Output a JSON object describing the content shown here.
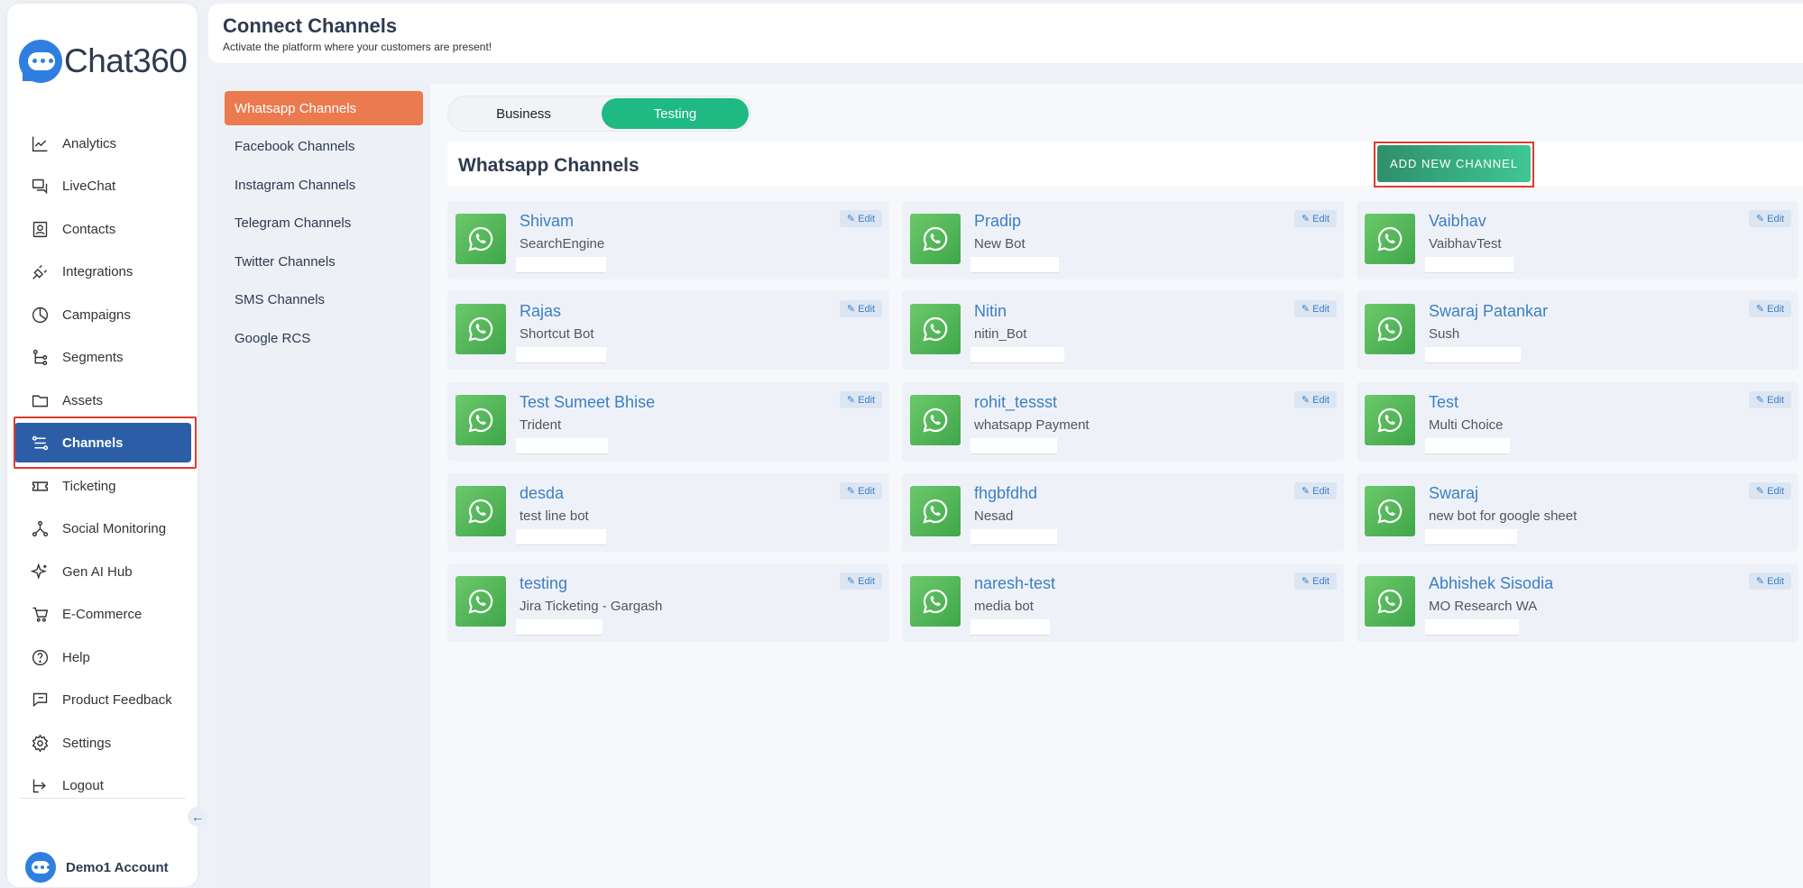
{
  "brand": {
    "name": "Chat360"
  },
  "sidebar": {
    "items": [
      {
        "label": "Analytics",
        "icon": "analytics-icon"
      },
      {
        "label": "LiveChat",
        "icon": "livechat-icon"
      },
      {
        "label": "Contacts",
        "icon": "contacts-icon"
      },
      {
        "label": "Integrations",
        "icon": "integrations-icon"
      },
      {
        "label": "Campaigns",
        "icon": "campaigns-icon"
      },
      {
        "label": "Segments",
        "icon": "segments-icon"
      },
      {
        "label": "Assets",
        "icon": "assets-icon"
      },
      {
        "label": "Channels",
        "icon": "channels-icon",
        "active": true
      },
      {
        "label": "Ticketing",
        "icon": "ticketing-icon"
      },
      {
        "label": "Social Monitoring",
        "icon": "social-monitoring-icon"
      },
      {
        "label": "Gen AI Hub",
        "icon": "sparkle-icon"
      },
      {
        "label": "E-Commerce",
        "icon": "cart-icon"
      },
      {
        "label": "Help",
        "icon": "help-icon"
      },
      {
        "label": "Product Feedback",
        "icon": "feedback-icon"
      },
      {
        "label": "Settings",
        "icon": "gear-icon"
      },
      {
        "label": "Logout",
        "icon": "logout-icon"
      }
    ],
    "account": "Demo1 Account"
  },
  "header": {
    "title": "Connect Channels",
    "subtitle": "Activate the platform where your customers are present!"
  },
  "channel_nav": [
    {
      "label": "Whatsapp Channels",
      "active": true
    },
    {
      "label": "Facebook Channels"
    },
    {
      "label": "Instagram Channels"
    },
    {
      "label": "Telegram Channels"
    },
    {
      "label": "Twitter Channels"
    },
    {
      "label": "SMS Channels"
    },
    {
      "label": "Google RCS"
    }
  ],
  "toggle": {
    "business": "Business",
    "testing": "Testing",
    "selected": "Testing"
  },
  "panel": {
    "title": "Whatsapp Channels",
    "add_label": "ADD NEW CHANNEL",
    "edit_label": "Edit"
  },
  "channels": [
    {
      "name": "Shivam",
      "bot": "SearchEngine"
    },
    {
      "name": "Pradip",
      "bot": "New Bot"
    },
    {
      "name": "Vaibhav",
      "bot": "VaibhavTest"
    },
    {
      "name": "Rajas",
      "bot": "Shortcut Bot"
    },
    {
      "name": "Nitin",
      "bot": "nitin_Bot"
    },
    {
      "name": "Swaraj Patankar",
      "bot": "Sush"
    },
    {
      "name": "Test Sumeet Bhise",
      "bot": "Trident"
    },
    {
      "name": "rohit_tessst",
      "bot": "whatsapp Payment"
    },
    {
      "name": "Test",
      "bot": "Multi Choice"
    },
    {
      "name": "desda",
      "bot": "test line bot"
    },
    {
      "name": "fhgbfdhd",
      "bot": "Nesad"
    },
    {
      "name": "Swaraj",
      "bot": "new bot for google sheet"
    },
    {
      "name": "testing",
      "bot": "Jira Ticketing - Gargash"
    },
    {
      "name": "naresh-test",
      "bot": "media bot"
    },
    {
      "name": "Abhishek Sisodia",
      "bot": "MO Research WA"
    }
  ],
  "colors": {
    "primary": "#2c5ea8",
    "accent_orange": "#eb7a4f",
    "green": "#1fb984",
    "highlight": "#e03a2f"
  }
}
